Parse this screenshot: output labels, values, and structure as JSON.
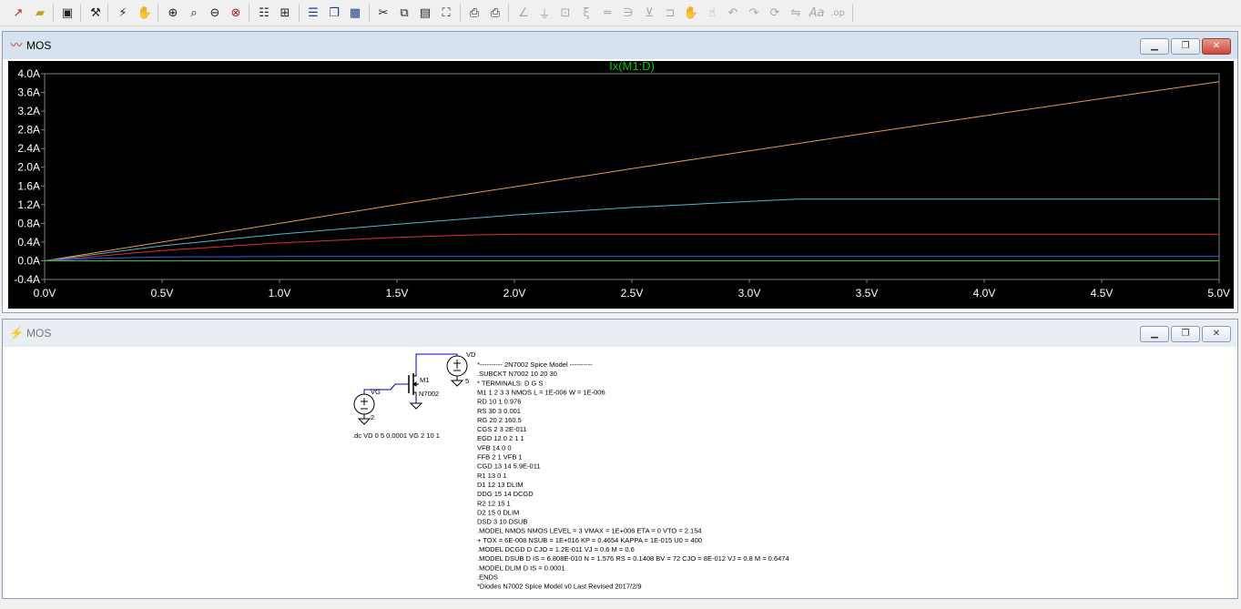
{
  "plot_window": {
    "title": "MOS",
    "trace_label": "Ix(M1:D)",
    "colors": {
      "background": "#000000",
      "axis": "#808080",
      "tick_text": "#ffffff",
      "label": "#00cc00"
    }
  },
  "chart_data": {
    "type": "line",
    "title": "Ix(M1:D)",
    "xlim": [
      0,
      5
    ],
    "ylim": [
      -0.4,
      4.0
    ],
    "x_ticks": [
      "0.0V",
      "0.5V",
      "1.0V",
      "1.5V",
      "2.0V",
      "2.5V",
      "3.0V",
      "3.5V",
      "4.0V",
      "4.5V",
      "5.0V"
    ],
    "y_ticks": [
      "4.0A",
      "3.6A",
      "3.2A",
      "2.8A",
      "2.4A",
      "2.0A",
      "1.6A",
      "1.2A",
      "0.8A",
      "0.4A",
      "0.0A",
      "-0.4A"
    ],
    "y_tick_values": [
      4.0,
      3.6,
      3.2,
      2.8,
      2.4,
      2.0,
      1.6,
      1.2,
      0.8,
      0.4,
      0.0,
      -0.4
    ],
    "x_tick_values": [
      0,
      0.5,
      1.0,
      1.5,
      2.0,
      2.5,
      3.0,
      3.5,
      4.0,
      4.5,
      5.0
    ],
    "grid": false,
    "series": [
      {
        "color": "#e69a4a",
        "x": [
          0,
          0.5,
          1.0,
          1.5,
          2.0,
          2.5,
          3.0,
          3.5,
          4.0,
          4.5,
          5.0
        ],
        "y": [
          0,
          0.4,
          0.8,
          1.2,
          1.58,
          1.97,
          2.35,
          2.73,
          3.1,
          3.47,
          3.83
        ]
      },
      {
        "color": "#4fb8c8",
        "x": [
          0,
          0.5,
          1.0,
          1.5,
          2.0,
          2.5,
          3.0,
          3.2,
          3.5,
          4.0,
          4.5,
          5.0
        ],
        "y": [
          0,
          0.32,
          0.57,
          0.78,
          0.98,
          1.14,
          1.27,
          1.32,
          1.32,
          1.32,
          1.32,
          1.32
        ]
      },
      {
        "color": "#e03030",
        "x": [
          0,
          0.5,
          1.0,
          1.5,
          1.8,
          2.0,
          3.0,
          4.0,
          5.0
        ],
        "y": [
          0,
          0.22,
          0.38,
          0.5,
          0.55,
          0.57,
          0.57,
          0.57,
          0.57
        ]
      },
      {
        "color": "#3060ff",
        "x": [
          0,
          0.2,
          0.5,
          1.0,
          2.0,
          3.0,
          4.0,
          5.0
        ],
        "y": [
          0,
          0.05,
          0.08,
          0.09,
          0.09,
          0.09,
          0.09,
          0.09
        ]
      },
      {
        "color": "#30c030",
        "x": [
          0,
          1.0,
          2.0,
          3.0,
          4.0,
          5.0
        ],
        "y": [
          0,
          0,
          0,
          0,
          0,
          0
        ]
      }
    ]
  },
  "schematic_window": {
    "title": "MOS",
    "labels": {
      "vd": "VD",
      "vd_value": "5",
      "vg": "VG",
      "vg_value": "2",
      "m1": "M1",
      "m1_model": "N7002"
    },
    "dc_command": ".dc VD 0 5 0.0001 VG 2 10 1",
    "netlist": [
      "*---------- 2N7002 Spice Model ----------",
      ".SUBCKT N7002 10 20 30",
      "*    TERMINALS:  D  G  S",
      "M1 1 2 3 3 NMOS L = 1E-006 W = 1E-006",
      "RD 10 1 0.976",
      "RS 30 3 0.001",
      "RG 20 2 160.5",
      "CGS 2 3 2E-011",
      "EGD 12 0 2 1 1",
      "VFB 14 0 0",
      "FFB 2 1 VFB 1",
      "CGD 13 14 5.9E-011",
      "R1 13 0 1",
      "D1 12 13 DLIM",
      "DDG 15 14 DCGD",
      "R2 12 15 1",
      "D2 15 0 DLIM",
      "DSD 3 10 DSUB",
      ".MODEL NMOS NMOS LEVEL = 3 VMAX = 1E+006 ETA = 0 VTO = 2.154",
      "+ TOX = 6E-008 NSUB = 1E+016 KP = 0.4654 KAPPA = 1E-015 U0 = 400",
      ".MODEL DCGD D CJO = 1.2E-011 VJ = 0.6 M = 0.6",
      ".MODEL DSUB D IS = 6.808E-010 N = 1.576 RS = 0.1408 BV = 72 CJO = 8E-012 VJ = 0.8 M = 0.6474",
      ".MODEL DLIM D IS = 0.0001",
      ".ENDS",
      "*Diodes N7002 Spice Model v0 Last Revised 2017/2/9"
    ]
  },
  "toolbar": {
    "icons": [
      "new-schematic-icon",
      "open-icon",
      "save-icon",
      "control-panel-icon",
      "run-icon",
      "halt-icon",
      "zoom-in-icon",
      "zoom-pan-icon",
      "zoom-out-icon",
      "zoom-fit-icon",
      "autorange-icon",
      "plot-settings-icon",
      "tile-horizontal-icon",
      "cascade-icon",
      "tile-vertical-icon",
      "cut-icon",
      "copy-icon",
      "paste-icon",
      "find-icon",
      "print-setup-icon",
      "print-icon",
      "wire-icon",
      "ground-icon",
      "label-icon",
      "resistor-icon",
      "capacitor-icon",
      "inductor-icon",
      "diode-icon",
      "component-icon",
      "move-icon",
      "drag-icon",
      "undo-icon",
      "redo-icon",
      "rotate-icon",
      "mirror-icon",
      "text-icon",
      "spice-directive-icon"
    ]
  }
}
